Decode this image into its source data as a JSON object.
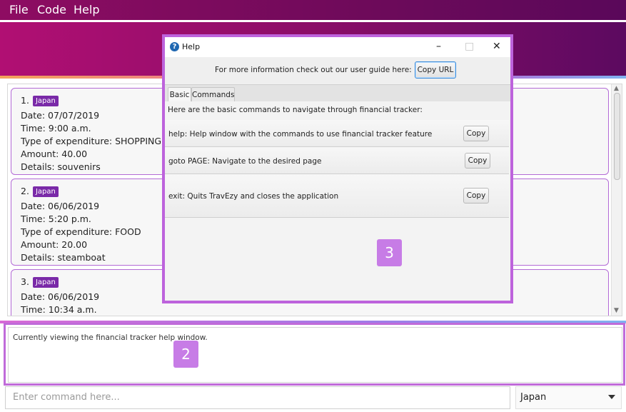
{
  "menu": {
    "file": "File",
    "code": "Code",
    "help": "Help"
  },
  "expenses": [
    {
      "index": "1.",
      "tag": "Japan",
      "date": "Date: 07/07/2019",
      "time": "Time: 9:00 a.m.",
      "type": "Type of expenditure: SHOPPING",
      "amount": "Amount: 40.00",
      "details": "Details: souvenirs"
    },
    {
      "index": "2.",
      "tag": "Japan",
      "date": "Date: 06/06/2019",
      "time": "Time: 5:20 p.m.",
      "type": "Type of expenditure: FOOD",
      "amount": "Amount: 20.00",
      "details": "Details: steamboat"
    },
    {
      "index": "3.",
      "tag": "Japan",
      "date": "Date: 06/06/2019",
      "time": "Time: 10:34 a.m."
    }
  ],
  "result": {
    "text": "Currently viewing the financial tracker help window."
  },
  "command": {
    "placeholder": "Enter command here..."
  },
  "country_select": {
    "selected": "Japan"
  },
  "help_window": {
    "title": "Help",
    "info_text": "For more information check out our user guide here: ...",
    "copy_url_label": "Copy URL",
    "tabs": [
      "Basic",
      "Commands"
    ],
    "intro": "Here are the basic commands to navigate through financial tracker:",
    "commands": [
      {
        "desc": "help: Help window with the commands to use financial tracker feature",
        "copy": "Copy"
      },
      {
        "desc": "goto PAGE: Navigate to the desired page",
        "copy": "Copy"
      },
      {
        "desc": "exit: Quits TravEzy and closes the application",
        "copy": "Copy"
      }
    ]
  },
  "annotations": {
    "badge_2": "2",
    "badge_3": "3"
  },
  "colors": {
    "accent": "#b36ad6",
    "tag": "#7a2aa8",
    "badge": "#c77ce6"
  }
}
